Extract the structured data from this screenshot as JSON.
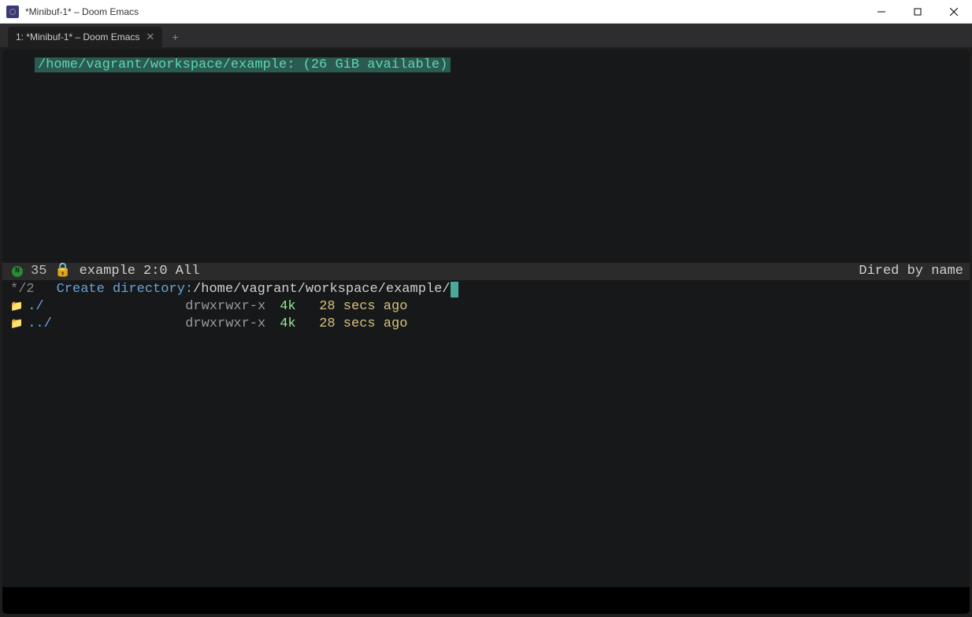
{
  "window": {
    "title": "*Minibuf-1* – Doom Emacs"
  },
  "tab": {
    "label": "1:  *Minibuf-1* – Doom Emacs"
  },
  "buffer_header": "/home/vagrant/workspace/example: (26 GiB available)",
  "modeline": {
    "number": "35",
    "name": "example",
    "position": "2:0 All",
    "right": "Dired by name"
  },
  "minibuf": {
    "marker": "*/2",
    "prompt": "Create directory: ",
    "path": "/home/vagrant/workspace/example/"
  },
  "entries": [
    {
      "name": "./",
      "perms": "drwxrwxr-x",
      "size": "4k",
      "time": "28 secs ago"
    },
    {
      "name": "../",
      "perms": "drwxrwxr-x",
      "size": "4k",
      "time": "28 secs ago"
    }
  ]
}
